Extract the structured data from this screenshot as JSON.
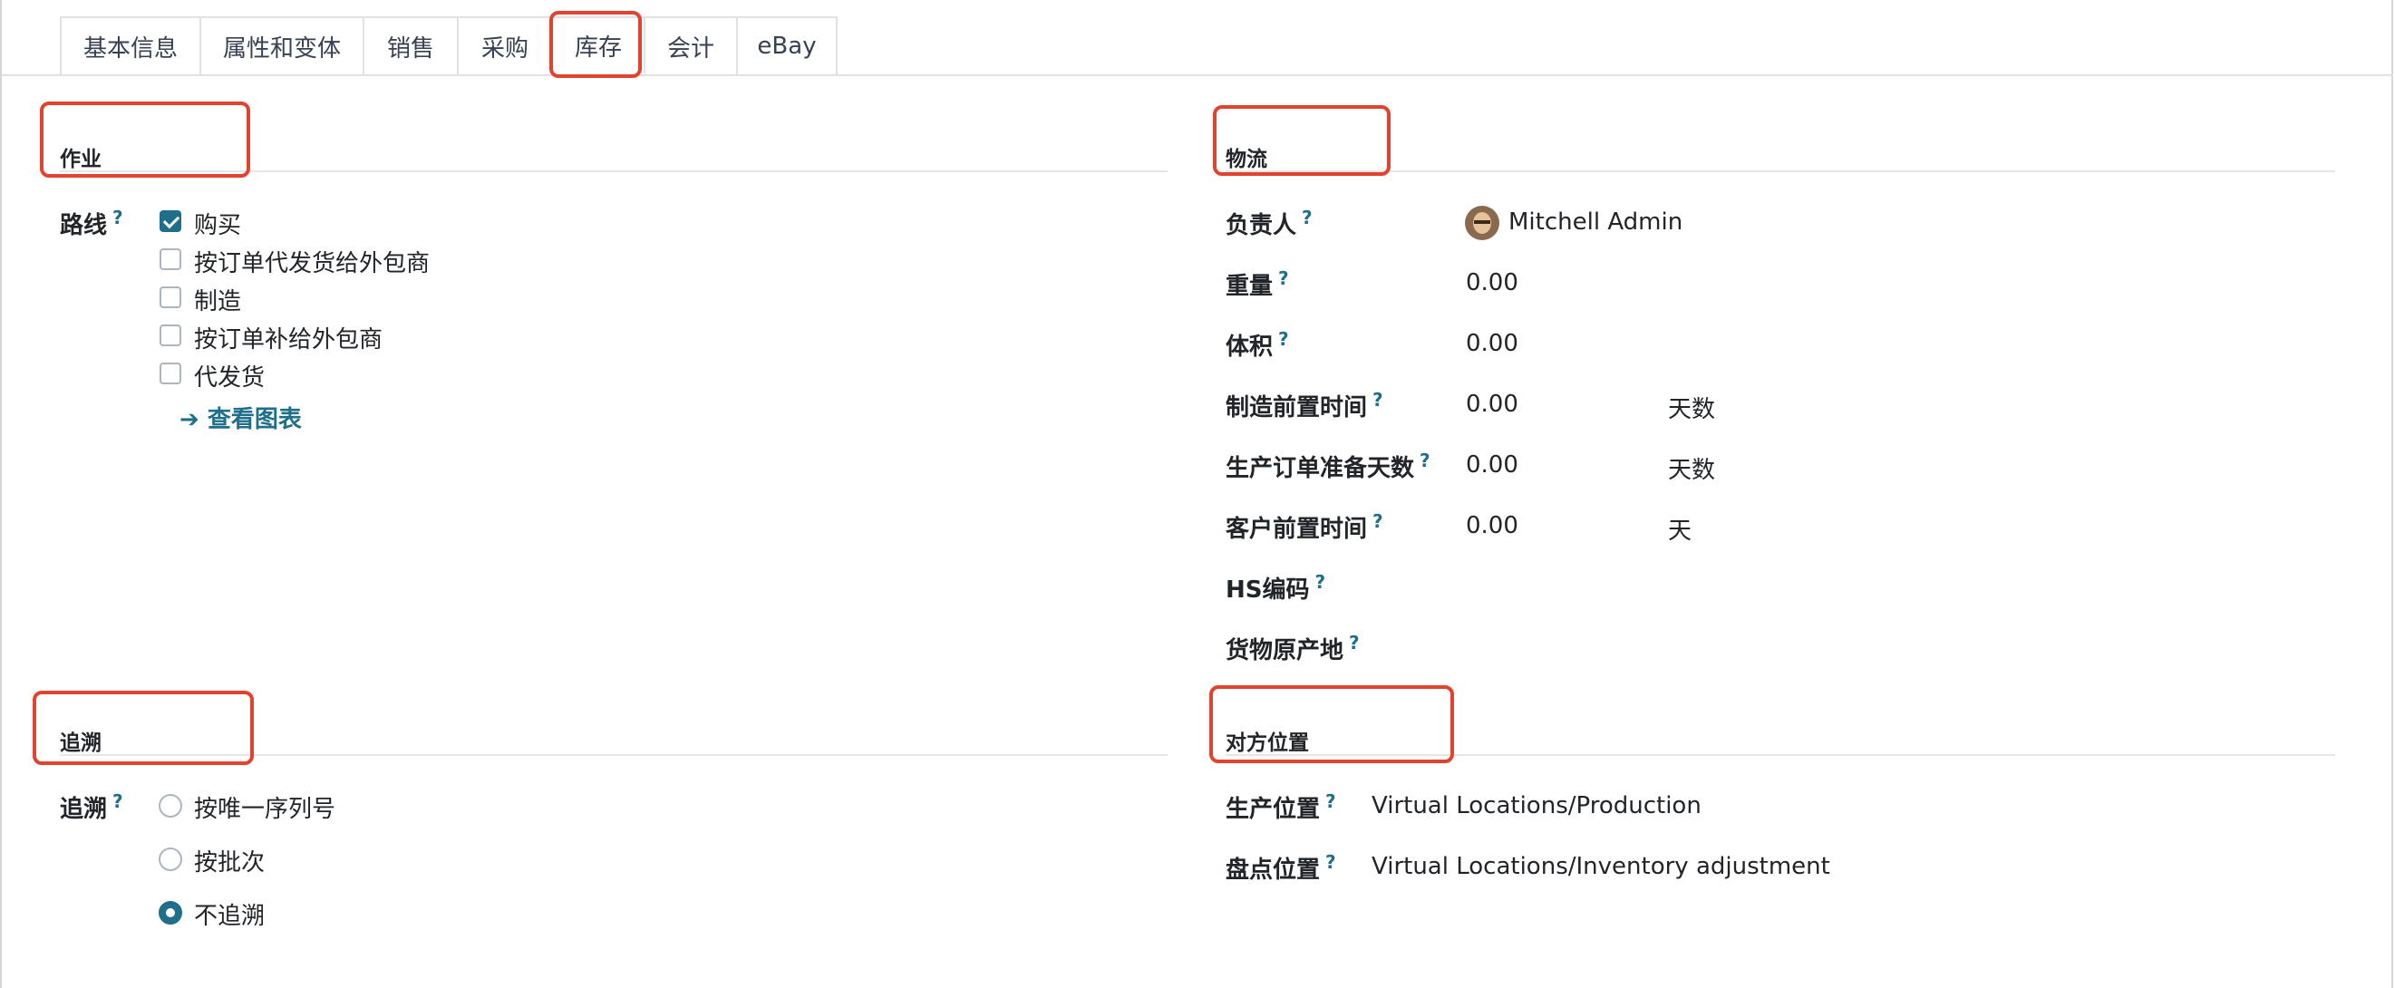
{
  "tabs": [
    {
      "label": "基本信息",
      "active": false
    },
    {
      "label": "属性和变体",
      "active": false
    },
    {
      "label": "销售",
      "active": false
    },
    {
      "label": "采购",
      "active": false
    },
    {
      "label": "库存",
      "active": true
    },
    {
      "label": "会计",
      "active": false
    },
    {
      "label": "eBay",
      "active": false
    }
  ],
  "operations": {
    "title": "作业",
    "routes_label": "路线",
    "routes": [
      {
        "label": "购买",
        "checked": true
      },
      {
        "label": "按订单代发货给外包商",
        "checked": false
      },
      {
        "label": "制造",
        "checked": false
      },
      {
        "label": "按订单补给外包商",
        "checked": false
      },
      {
        "label": "代发货",
        "checked": false
      }
    ],
    "view_diagram": "查看图表"
  },
  "logistics": {
    "title": "物流",
    "responsible_label": "负责人",
    "responsible_value": "Mitchell Admin",
    "weight_label": "重量",
    "weight_value": "0.00",
    "volume_label": "体积",
    "volume_value": "0.00",
    "mfg_lead_label": "制造前置时间",
    "mfg_lead_value": "0.00",
    "mfg_lead_unit": "天数",
    "mo_prep_label": "生产订单准备天数",
    "mo_prep_value": "0.00",
    "mo_prep_unit": "天数",
    "customer_lead_label": "客户前置时间",
    "customer_lead_value": "0.00",
    "customer_lead_unit": "天",
    "hs_label": "HS编码",
    "origin_label": "货物原产地"
  },
  "traceability": {
    "title": "追溯",
    "tracking_label": "追溯",
    "options": [
      {
        "label": "按唯一序列号",
        "checked": false
      },
      {
        "label": "按批次",
        "checked": false
      },
      {
        "label": "不追溯",
        "checked": true
      }
    ]
  },
  "counterpart": {
    "title": "对方位置",
    "production_label": "生产位置",
    "production_value": "Virtual Locations/Production",
    "inventory_label": "盘点位置",
    "inventory_value": "Virtual Locations/Inventory adjustment"
  },
  "colors": {
    "accent": "#1f6f8b",
    "highlight": "#e0442f"
  }
}
